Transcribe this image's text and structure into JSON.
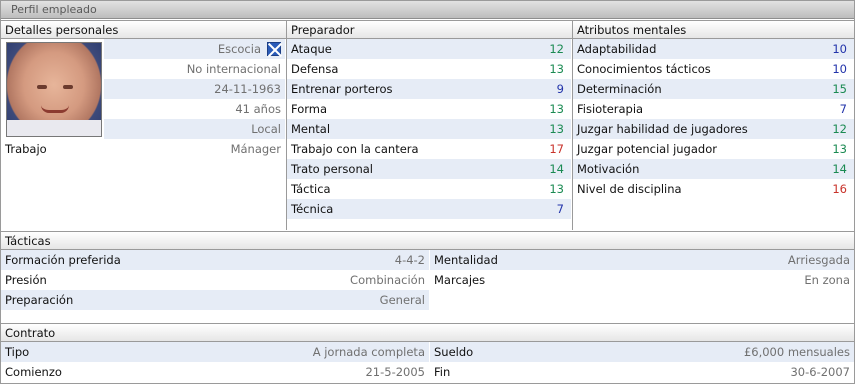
{
  "window": {
    "title": "Perfil empleado"
  },
  "personal": {
    "header": "Detalles personales",
    "nation": "Escocia",
    "intl": "No internacional",
    "dob": "24-11-1963",
    "age": "41 años",
    "status": "Local",
    "job_label": "Trabajo",
    "job_value": "Mánager"
  },
  "coach": {
    "header": "Preparador",
    "items": [
      {
        "label": "Ataque",
        "value": "12",
        "color": "#1a8a52"
      },
      {
        "label": "Defensa",
        "value": "13",
        "color": "#1a8a52"
      },
      {
        "label": "Entrenar porteros",
        "value": "9",
        "color": "#2233aa"
      },
      {
        "label": "Forma",
        "value": "13",
        "color": "#1a8a52"
      },
      {
        "label": "Mental",
        "value": "13",
        "color": "#1a8a52"
      },
      {
        "label": "Trabajo con la cantera",
        "value": "17",
        "color": "#c8322a"
      },
      {
        "label": "Trato personal",
        "value": "14",
        "color": "#1a8a52"
      },
      {
        "label": "Táctica",
        "value": "13",
        "color": "#1a8a52"
      },
      {
        "label": "Técnica",
        "value": "7",
        "color": "#2233aa"
      }
    ]
  },
  "mental": {
    "header": "Atributos mentales",
    "items": [
      {
        "label": "Adaptabilidad",
        "value": "10",
        "color": "#2233aa"
      },
      {
        "label": "Conocimientos tácticos",
        "value": "10",
        "color": "#2233aa"
      },
      {
        "label": "Determinación",
        "value": "15",
        "color": "#1a8a52"
      },
      {
        "label": "Fisioterapia",
        "value": "7",
        "color": "#2233aa"
      },
      {
        "label": "Juzgar habilidad de jugadores",
        "value": "12",
        "color": "#1a8a52"
      },
      {
        "label": "Juzgar potencial jugador",
        "value": "13",
        "color": "#1a8a52"
      },
      {
        "label": "Motivación",
        "value": "14",
        "color": "#1a8a52"
      },
      {
        "label": "Nivel de disciplina",
        "value": "16",
        "color": "#c8322a"
      }
    ]
  },
  "tactics": {
    "header": "Tácticas",
    "formation_label": "Formación preferida",
    "formation_value": "4-4-2",
    "mentality_label": "Mentalidad",
    "mentality_value": "Arriesgada",
    "pressing_label": "Presión",
    "pressing_value": "Combinación",
    "marking_label": "Marcajes",
    "marking_value": "En zona",
    "training_label": "Preparación",
    "training_value": "General"
  },
  "contract": {
    "header": "Contrato",
    "type_label": "Tipo",
    "type_value": "A jornada completa",
    "wage_label": "Sueldo",
    "wage_value": "£6,000 mensuales",
    "start_label": "Comienzo",
    "start_value": "21-5-2005",
    "end_label": "Fin",
    "end_value": "30-6-2007"
  }
}
